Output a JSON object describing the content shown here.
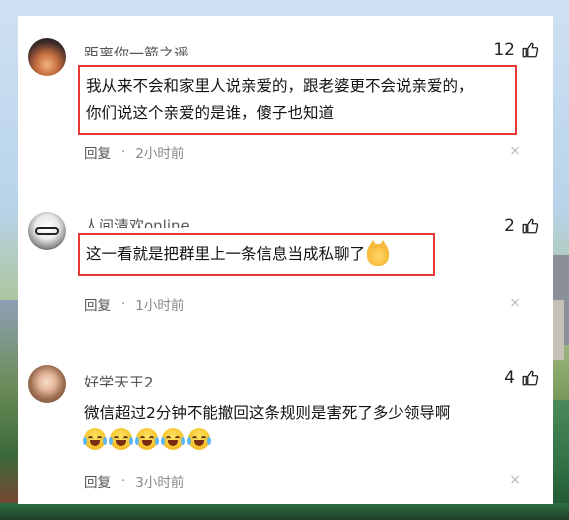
{
  "comments": [
    {
      "username": "距离你一箭之遥",
      "likes": "12",
      "text_line1": "我从来不会和家里人说亲爱的，跟老婆更不会说亲爱的，",
      "text_line2": "你们说这个亲爱的是谁，傻子也知道",
      "reply": "回复",
      "dot": "·",
      "time": "2小时前",
      "close": "×"
    },
    {
      "username": "人间清欢online",
      "likes": "2",
      "text_line1": "这一看就是把群里上一条信息当成私聊了",
      "reply": "回复",
      "dot": "·",
      "time": "1小时前",
      "close": "×"
    },
    {
      "username": "好学天王2",
      "likes": "4",
      "text_line1": "微信超过2分钟不能撤回这条规则是害死了多少领导啊",
      "reply": "回复",
      "dot": "·",
      "time": "3小时前",
      "close": "×"
    }
  ],
  "icons": {
    "like": "thumbs-up-icon",
    "laugh": "laughing-tears-emoji",
    "cat": "grinning-cat-emoji"
  },
  "colors": {
    "highlight_border": "#e53935",
    "meta_text": "#888888"
  }
}
